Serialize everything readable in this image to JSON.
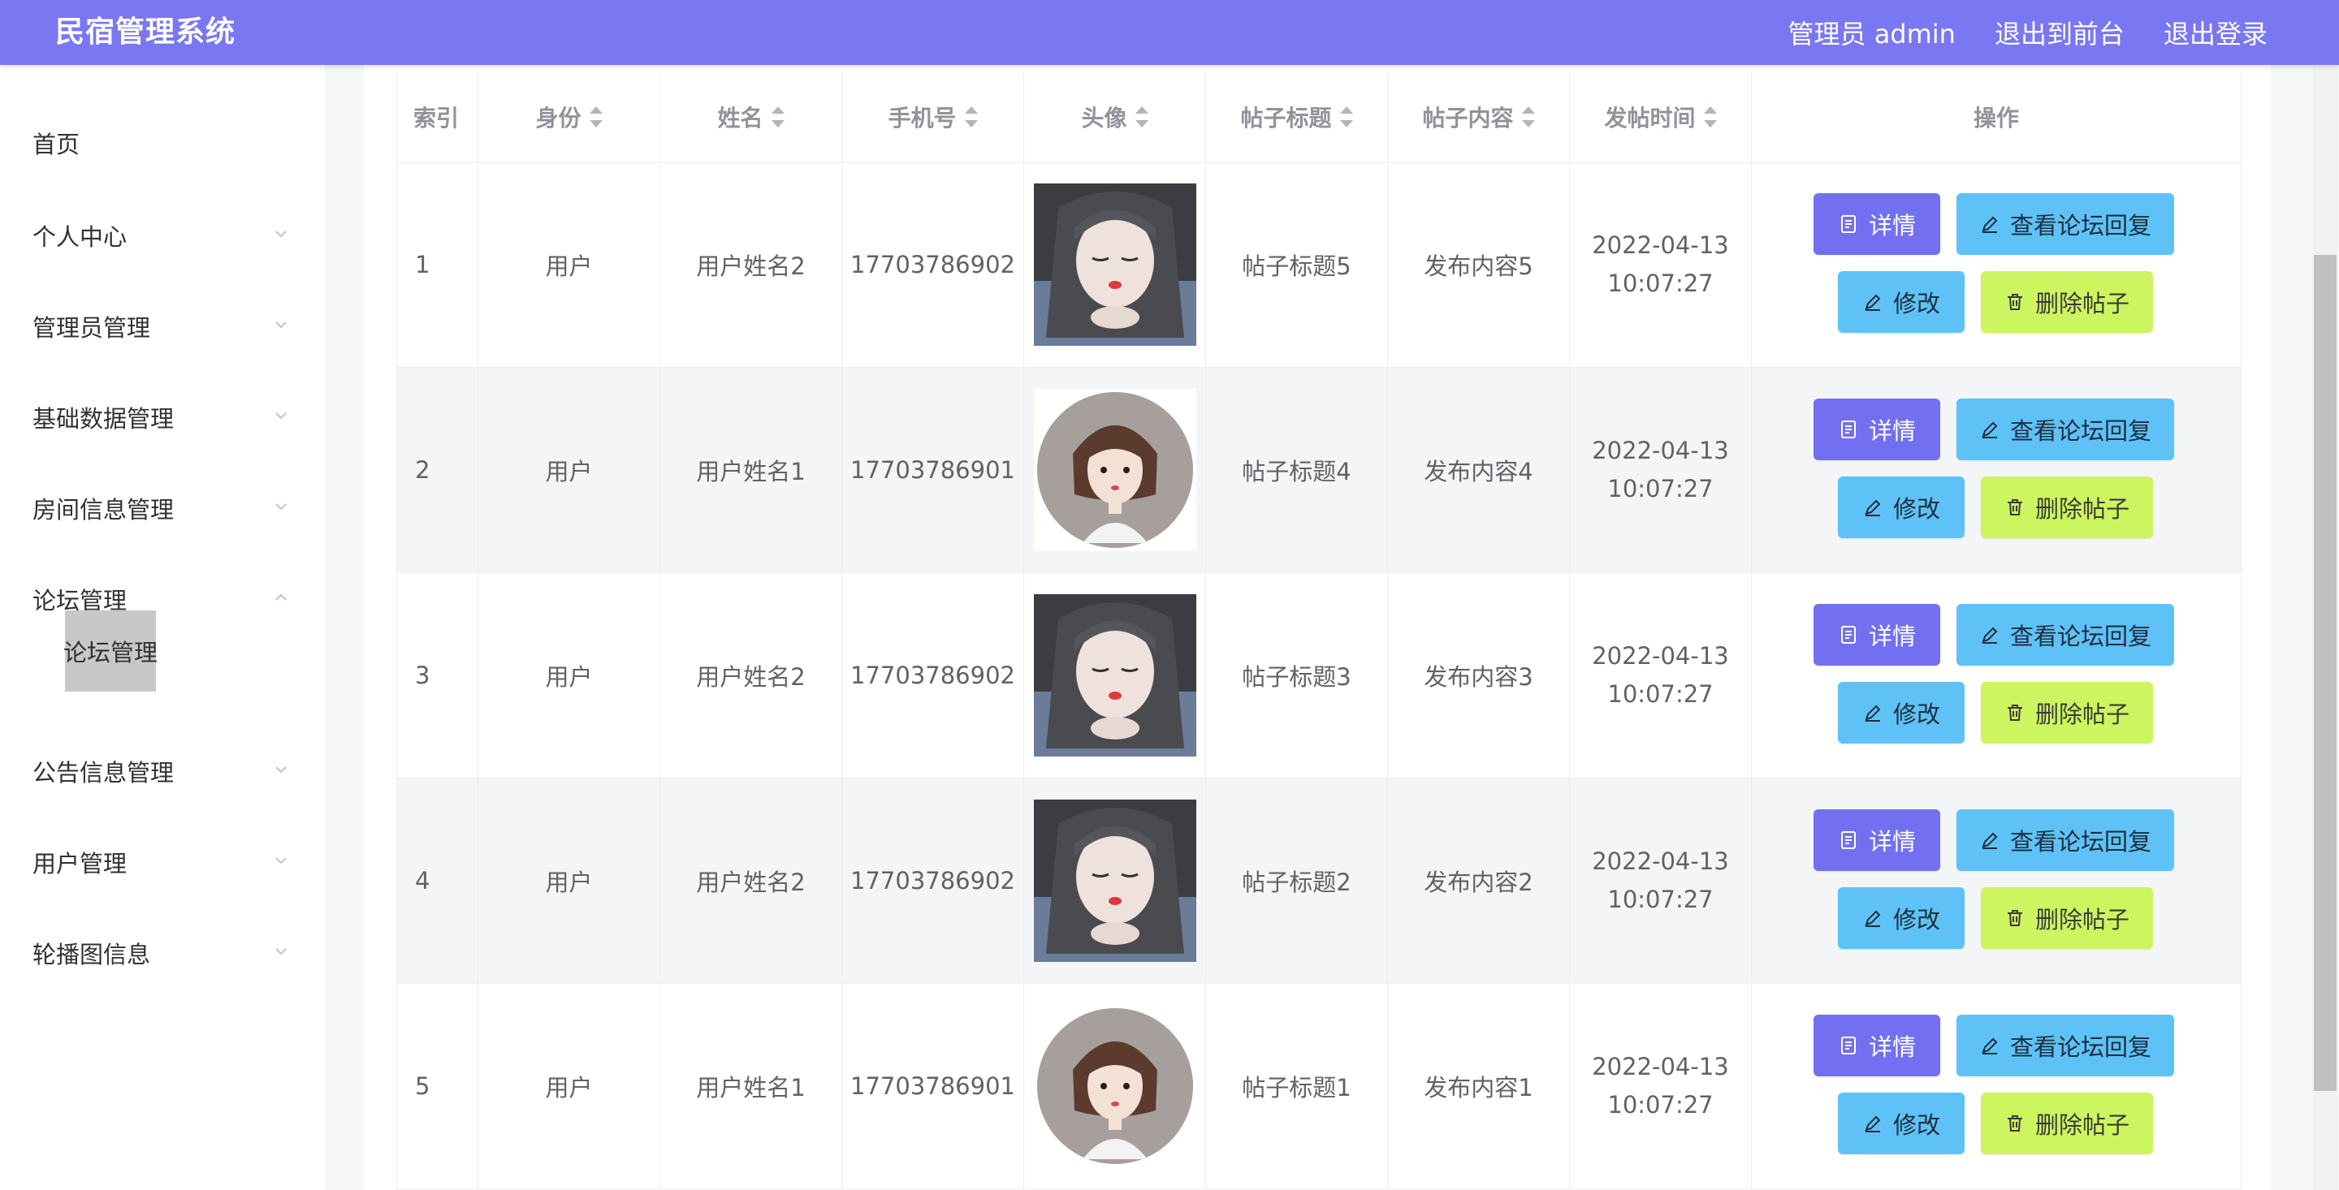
{
  "header": {
    "brand": "民宿管理系统",
    "admin_label": "管理员 admin",
    "frontend_link": "退出到前台",
    "logout_link": "退出登录"
  },
  "sidebar": {
    "items": [
      {
        "label": "首页"
      },
      {
        "label": "个人中心"
      },
      {
        "label": "管理员管理"
      },
      {
        "label": "基础数据管理"
      },
      {
        "label": "房间信息管理"
      },
      {
        "label": "论坛管理"
      },
      {
        "label": "公告信息管理"
      },
      {
        "label": "用户管理"
      },
      {
        "label": "轮播图信息"
      }
    ],
    "active_submenu": "论坛管理"
  },
  "table": {
    "headers": {
      "index": "索引",
      "role": "身份",
      "name": "姓名",
      "phone": "手机号",
      "avatar": "头像",
      "title": "帖子标题",
      "content": "帖子内容",
      "time": "发帖时间",
      "ops": "操作"
    },
    "buttons": {
      "detail": "详情",
      "reply": "查看论坛回复",
      "edit": "修改",
      "delete": "删除帖子"
    },
    "rows": [
      {
        "index": "1",
        "role": "用户",
        "name": "用户姓名2",
        "phone": "17703786902",
        "avatar": "girl-closed-eyes",
        "title": "帖子标题5",
        "content": "发布内容5",
        "time": "2022-04-13 10:07:27"
      },
      {
        "index": "2",
        "role": "用户",
        "name": "用户姓名1",
        "phone": "17703786901",
        "avatar": "girl-illustration",
        "title": "帖子标题4",
        "content": "发布内容4",
        "time": "2022-04-13 10:07:27"
      },
      {
        "index": "3",
        "role": "用户",
        "name": "用户姓名2",
        "phone": "17703786902",
        "avatar": "girl-closed-eyes",
        "title": "帖子标题3",
        "content": "发布内容3",
        "time": "2022-04-13 10:07:27"
      },
      {
        "index": "4",
        "role": "用户",
        "name": "用户姓名2",
        "phone": "17703786902",
        "avatar": "girl-closed-eyes",
        "title": "帖子标题2",
        "content": "发布内容2",
        "time": "2022-04-13 10:07:27"
      },
      {
        "index": "5",
        "role": "用户",
        "name": "用户姓名1",
        "phone": "17703786901",
        "avatar": "girl-illustration",
        "title": "帖子标题1",
        "content": "发布内容1",
        "time": "2022-04-13 10:07:27"
      }
    ]
  },
  "colors": {
    "header_bg": "#7a77f2",
    "detail_button": "#7270f0",
    "reply_button": "#5ec2f7",
    "edit_button": "#5ec2f7",
    "delete_button": "#cdf55f",
    "active_submenu_bg": "#c8c8c8"
  }
}
